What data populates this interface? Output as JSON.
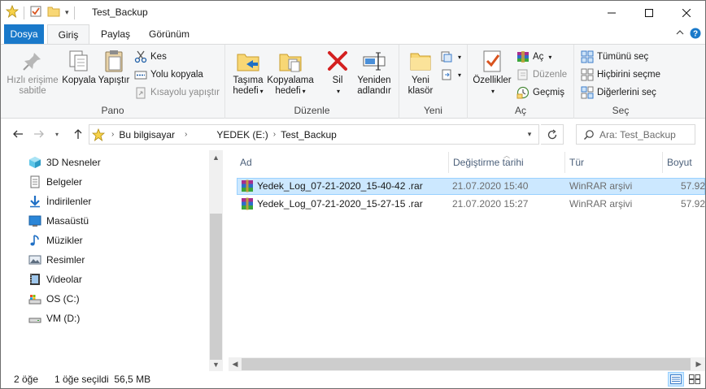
{
  "window": {
    "title": "Test_Backup",
    "minimize_icon": "minimize-icon",
    "maximize_icon": "maximize-icon",
    "close_icon": "close-icon"
  },
  "ribbon_tabs": {
    "file": "Dosya",
    "home": "Giriş",
    "share": "Paylaş",
    "view": "Görünüm"
  },
  "ribbon": {
    "clipboard": {
      "label": "Pano",
      "pin_label_1": "Hızlı erişime",
      "pin_label_2": "sabitle",
      "copy": "Kopyala",
      "paste": "Yapıştır",
      "cut": "Kes",
      "copy_path": "Yolu kopyala",
      "paste_shortcut": "Kısayolu yapıştır"
    },
    "organize": {
      "label": "Düzenle",
      "move_to_1": "Taşıma",
      "move_to_2": "hedefi",
      "copy_to_1": "Kopyalama",
      "copy_to_2": "hedefi",
      "delete": "Sil",
      "rename_1": "Yeniden",
      "rename_2": "adlandır"
    },
    "new": {
      "label": "Yeni",
      "new_folder_1": "Yeni",
      "new_folder_2": "klasör"
    },
    "open": {
      "label": "Aç",
      "properties": "Özellikler",
      "open": "Aç",
      "edit": "Düzenle",
      "history": "Geçmiş"
    },
    "select": {
      "label": "Seç",
      "select_all": "Tümünü seç",
      "select_none": "Hiçbirini seçme",
      "invert": "Diğerlerini seç"
    }
  },
  "address": {
    "crumbs": [
      "Bu bilgisayar",
      "YEDEK (E:)",
      "Test_Backup"
    ],
    "search_placeholder": "Ara: Test_Backup"
  },
  "nav_pane": {
    "items": [
      {
        "label": "3D Nesneler",
        "icon": "3d-objects-icon"
      },
      {
        "label": "Belgeler",
        "icon": "documents-icon"
      },
      {
        "label": "İndirilenler",
        "icon": "downloads-icon"
      },
      {
        "label": "Masaüstü",
        "icon": "desktop-icon"
      },
      {
        "label": "Müzikler",
        "icon": "music-icon"
      },
      {
        "label": "Resimler",
        "icon": "pictures-icon"
      },
      {
        "label": "Videolar",
        "icon": "videos-icon"
      },
      {
        "label": "OS (C:)",
        "icon": "drive-c-icon"
      },
      {
        "label": "VM (D:)",
        "icon": "drive-d-icon"
      }
    ]
  },
  "file_list": {
    "columns": [
      "Ad",
      "Değiştirme tarihi",
      "Tür",
      "Boyut"
    ],
    "rows": [
      {
        "name": "Yedek_Log_07-21-2020_15-40-42 .rar",
        "date": "21.07.2020 15:40",
        "type": "WinRAR arşivi",
        "size": "57.92",
        "selected": true
      },
      {
        "name": "Yedek_Log_07-21-2020_15-27-15 .rar",
        "date": "21.07.2020 15:27",
        "type": "WinRAR arşivi",
        "size": "57.92",
        "selected": false
      }
    ]
  },
  "status": {
    "count": "2 öğe",
    "selection": "1 öğe seçildi  56,5 MB"
  },
  "colors": {
    "file_tab": "#1979ca",
    "selection": "#cce8ff",
    "selection_border": "#99d1ff",
    "header_text": "#4c607a"
  }
}
